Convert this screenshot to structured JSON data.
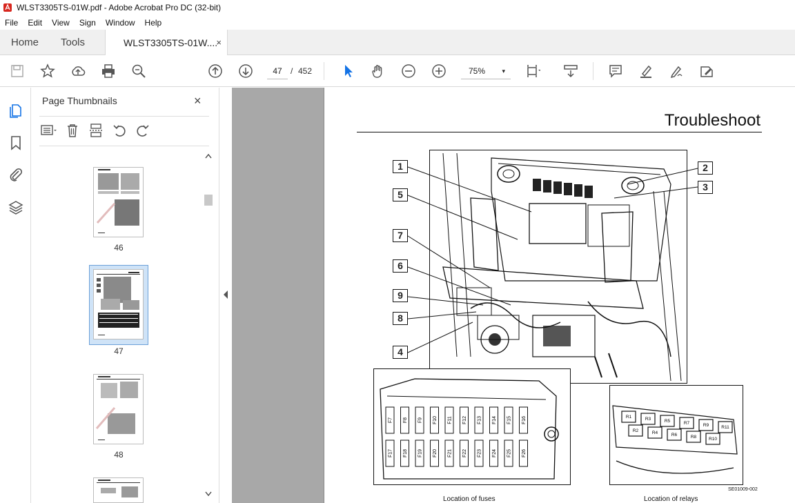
{
  "window": {
    "title": "WLST3305TS-01W.pdf - Adobe Acrobat Pro DC (32-bit)"
  },
  "menu": [
    "File",
    "Edit",
    "View",
    "Sign",
    "Window",
    "Help"
  ],
  "tabs": {
    "home": "Home",
    "tools": "Tools",
    "document": "WLST3305TS-01W....",
    "close": "×"
  },
  "toolbar": {
    "current_page": "47",
    "separator": "/",
    "total_pages": "452",
    "zoom": "75%",
    "zoom_caret": "▾"
  },
  "thumbnails_panel": {
    "title": "Page Thumbnails",
    "close": "×",
    "pages": [
      "46",
      "47",
      "48"
    ],
    "selected_page": "47"
  },
  "document_page": {
    "heading": "Troubleshoot",
    "callouts": [
      "1",
      "2",
      "3",
      "5",
      "7",
      "6",
      "9",
      "8",
      "4"
    ],
    "captions": {
      "fuses": "Location of fuses",
      "relays": "Location of relays"
    },
    "figure_code": "SE01009-002",
    "fuse_labels_top": [
      "F7",
      "F8",
      "F9",
      "F10",
      "F11",
      "F12",
      "F13",
      "F14",
      "F15",
      "F16"
    ],
    "fuse_labels_bottom": [
      "F17",
      "F18",
      "F19",
      "F20",
      "F21",
      "F22",
      "F23",
      "F24",
      "F25",
      "F26"
    ],
    "relay_labels": [
      "R1",
      "R2",
      "R3",
      "R4",
      "R5",
      "R6",
      "R7",
      "R8",
      "R9",
      "R10",
      "R11"
    ]
  },
  "colors": {
    "accent": "#1473e6",
    "selection": "#cfe3f7",
    "canvas": "#a8a8a8"
  }
}
